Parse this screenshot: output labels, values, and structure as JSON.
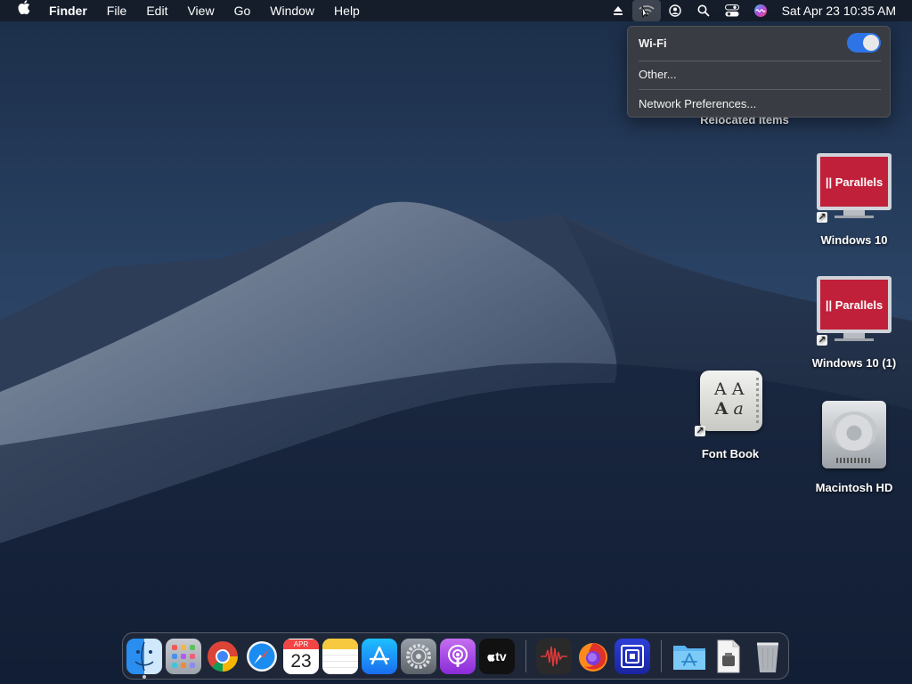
{
  "menubar": {
    "apple_icon": "apple-icon",
    "items": [
      "Finder",
      "File",
      "Edit",
      "View",
      "Go",
      "Window",
      "Help"
    ],
    "status_icons": [
      "eject-icon",
      "wifi-icon",
      "user-icon",
      "search-icon",
      "control-center-icon",
      "siri-icon"
    ],
    "clock": "Sat Apr 23  10:35 AM"
  },
  "wifi_menu": {
    "title": "Wi-Fi",
    "toggle_on": true,
    "items": [
      "Other...",
      "Network Preferences..."
    ]
  },
  "desktop": {
    "partial_label": "Relocated Items",
    "items": [
      {
        "label": "Windows 10",
        "icon": "parallels-vm-icon",
        "brand": "|| Parallels"
      },
      {
        "label": "Windows 10 (1)",
        "icon": "parallels-vm-icon",
        "brand": "|| Parallels"
      },
      {
        "label": "Font Book",
        "icon": "font-book-icon"
      },
      {
        "label": "Macintosh HD",
        "icon": "hard-drive-icon"
      }
    ]
  },
  "dock": {
    "calendar": {
      "month": "APR",
      "day": "23"
    },
    "apps": [
      "finder-icon",
      "launchpad-icon",
      "chrome-icon",
      "safari-icon",
      "calendar-icon",
      "notes-icon",
      "app-store-icon",
      "system-preferences-icon",
      "podcasts-icon",
      "apple-tv-icon",
      "audio-recorder-icon",
      "firefox-icon",
      "remote-desktop-icon",
      "applications-folder-icon",
      "document-icon",
      "trash-icon"
    ],
    "appletv_label": "tv"
  },
  "colors": {
    "accent": "#2e74e6",
    "parallels_red": "#c0203a"
  }
}
